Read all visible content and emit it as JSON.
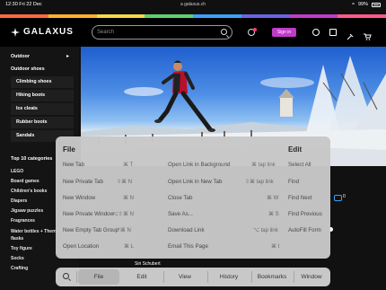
{
  "status": {
    "time_date": "12:30  Fri 22 Dec",
    "url": "a galaxus.ch",
    "battery": "99%"
  },
  "brand_colors": [
    "#ff6b3d",
    "#ffb02e",
    "#f6d84a",
    "#5fcf6e",
    "#3aa0ff",
    "#6a63e6",
    "#c13bcb",
    "#ff5a8a"
  ],
  "header": {
    "logo": "GALAXUS",
    "search_placeholder": "Search",
    "signin": "Sign in"
  },
  "sidebar": {
    "items": [
      "Outdoor",
      "Outdoor shoes"
    ],
    "sub_items": [
      "Climbing shoes",
      "Hiking boots",
      "Ice cleats",
      "Rubber boots",
      "Sandals"
    ],
    "categories_title": "Top 10 categories",
    "categories": [
      "LEGO",
      "Board games",
      "Children's books",
      "Diapers",
      "Jigsaw puzzles",
      "Fragrances",
      "Water bottles + Thermo flasks",
      "Toy figure",
      "Socks",
      "Crafting"
    ]
  },
  "chat_count": "0",
  "peek_text": "Siri Schubert",
  "menu": {
    "file_title": "File",
    "edit_title": "Edit",
    "col1": [
      {
        "label": "New Tab",
        "shortcut": "⌘ T"
      },
      {
        "label": "New Private Tab",
        "shortcut": "⇧⌘ N"
      },
      {
        "label": "New Window",
        "shortcut": "⌘ N"
      },
      {
        "label": "New Private Window",
        "shortcut": "⌥⇧⌘ N"
      },
      {
        "label": "New Empty Tab Group",
        "shortcut": "^⌘ N"
      },
      {
        "label": "Open Location",
        "shortcut": "⌘ L"
      }
    ],
    "col2": [
      {
        "label": "Open Link in Background",
        "shortcut": "⌘ tap link"
      },
      {
        "label": "Open Link in New Tab",
        "shortcut": "⇧⌘ tap link"
      },
      {
        "label": "Close Tab",
        "shortcut": "⌘ W"
      },
      {
        "label": "Save As...",
        "shortcut": "⌘ S"
      },
      {
        "label": "Download Link",
        "shortcut": "⌥ tap link"
      },
      {
        "label": "Email This Page",
        "shortcut": "⌘ I"
      }
    ],
    "col3": [
      "Select All",
      "Find",
      "Find Next",
      "Find Previous",
      "AutoFill Form"
    ]
  },
  "bottombar": [
    "File",
    "Edit",
    "View",
    "History",
    "Bookmarks",
    "Window"
  ]
}
